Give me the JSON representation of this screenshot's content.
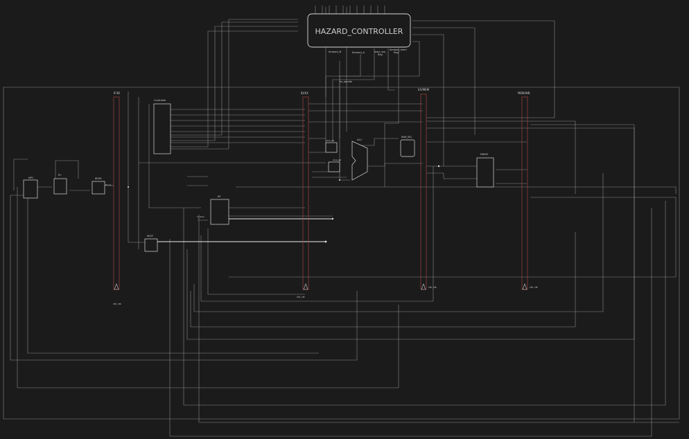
{
  "colors": {
    "background": "#1b1b1b",
    "wire": "#9a9a9a",
    "wire_bright": "#e6e6e6",
    "box_stroke": "#d8d8d8",
    "register_bar": "#6a2828",
    "text": "#cfcfcf"
  },
  "hazard": {
    "title": "HAZARD_CONTROLLER",
    "out_forward_b": "forward_B",
    "out_forward_a": "forward_A",
    "out_load_use": "load_use_",
    "out_load_use_2": "flag",
    "out_forward_mem": "forward_mem",
    "out_forward_mem_2": "flag"
  },
  "registers": {
    "ifid": "IF/ID",
    "idex": "ID/EX",
    "exmem": "EX/MEM",
    "memwb": "MEM/WB",
    "clk_rst": "clk, rst"
  },
  "modules": {
    "npc": "NPC",
    "pc": "PC",
    "irom": "IROM",
    "controller": "Controller",
    "rf": "RF",
    "sext": "SEXT",
    "alu": "ALU",
    "alu_mux_b": "alub_sel",
    "alu_mux_a": "alua_sel",
    "ram_sel": "RAM_SEL",
    "dram": "DRAM",
    "ex_opcode": "ex_opcode",
    "rf_wsel": "rf_wsel",
    "pc4": "PC+4"
  }
}
